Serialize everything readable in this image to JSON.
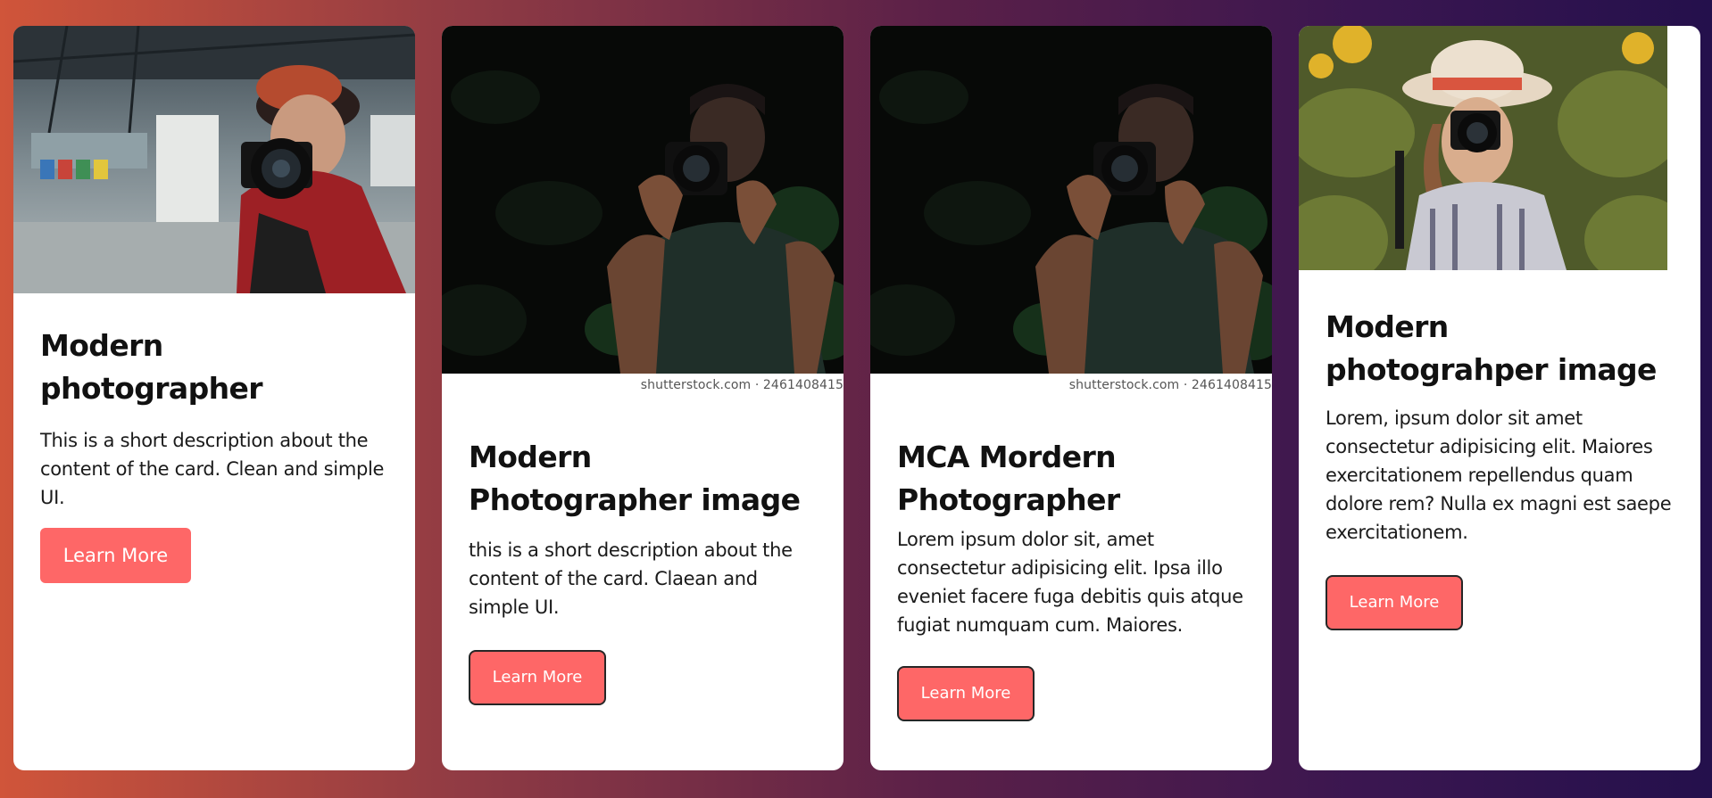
{
  "cards": [
    {
      "title": "Modern photographer",
      "description": "This is a short description about the content of the card. Clean and simple UI.",
      "button_label": "Learn More"
    },
    {
      "title": "Modern Photographer image",
      "description": "this is a short description about the content of the card. Claean and simple UI.",
      "button_label": "Learn More",
      "watermark": "shutterstock.com · 2461408415"
    },
    {
      "title": "MCA Mordern Photographer",
      "description": "Lorem ipsum dolor sit, amet consectetur adipisicing elit. Ipsa illo eveniet facere fuga debitis quis atque fugiat numquam cum. Maiores.",
      "button_label": "Learn More",
      "watermark": "shutterstock.com · 2461408415"
    },
    {
      "title": "Modern photograhper image",
      "description": "Lorem, ipsum dolor sit amet consectetur adipisicing elit. Maiores exercitationem repellendus quam dolore rem? Nulla ex magni est saepe exercitationem.",
      "button_label": "Learn More"
    }
  ],
  "colors": {
    "button": "#fe6767",
    "card": "#ffffff",
    "gradient_start": "#d0553a",
    "gradient_end": "#24104c"
  }
}
